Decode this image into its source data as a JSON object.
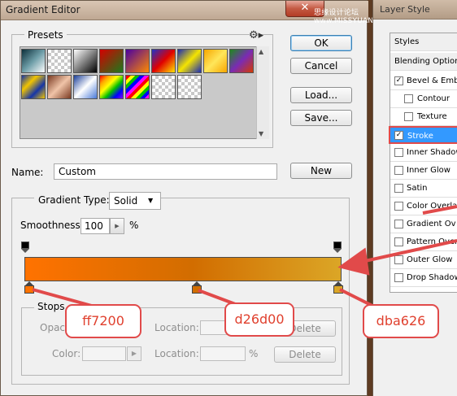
{
  "gradient_editor": {
    "title": "Gradient Editor",
    "watermark": "思缘设计论坛 www.MISSYUAN.COM",
    "presets_label": "Presets",
    "buttons": {
      "ok": "OK",
      "cancel": "Cancel",
      "load": "Load...",
      "save": "Save...",
      "new": "New"
    },
    "name_label": "Name:",
    "name_value": "Custom",
    "gradient_type_label": "Gradient Type:",
    "gradient_type_value": "Solid",
    "smoothness_label": "Smoothness:",
    "smoothness_value": "100",
    "smoothness_unit": "%",
    "gradient_colors": [
      "#ff7200",
      "#d26d00",
      "#dba626"
    ],
    "stops": {
      "label": "Stops",
      "opacity_label": "Opac",
      "color_label": "Color:",
      "location_label": "Location:",
      "percent": "%",
      "delete": "Delete"
    }
  },
  "callouts": [
    "ff7200",
    "d26d00",
    "dba626"
  ],
  "layer_style": {
    "title": "Layer Style",
    "items": [
      {
        "label": "Styles",
        "type": "header"
      },
      {
        "label": "Blending Options",
        "type": "header"
      },
      {
        "label": "Bevel & Emboss",
        "checked": true
      },
      {
        "label": "Contour",
        "checked": false,
        "indent": true
      },
      {
        "label": "Texture",
        "checked": false,
        "indent": true
      },
      {
        "label": "Stroke",
        "checked": true,
        "selected": true
      },
      {
        "label": "Inner Shadow",
        "checked": false
      },
      {
        "label": "Inner Glow",
        "checked": false
      },
      {
        "label": "Satin",
        "checked": false
      },
      {
        "label": "Color Overlay",
        "checked": false
      },
      {
        "label": "Gradient Ov",
        "checked": false
      },
      {
        "label": "Pattern Overla",
        "checked": false
      },
      {
        "label": "Outer Glow",
        "checked": false
      },
      {
        "label": "Drop Shadow",
        "checked": false
      }
    ]
  },
  "colors": {
    "accent_red": "#e14a4a",
    "selection_blue": "#3399ff"
  }
}
